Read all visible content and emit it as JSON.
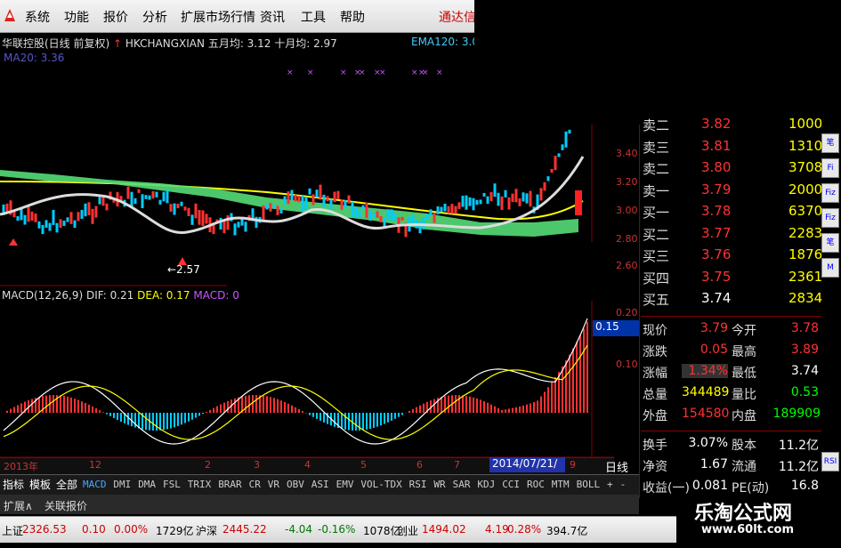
{
  "menu": {
    "items": [
      "系统",
      "功能",
      "报价",
      "分析",
      "扩展市场行情",
      "资讯",
      "工具",
      "帮助"
    ],
    "brand": "通达信"
  },
  "chart_header": {
    "stock_name": "华联控股(日线 前复权)",
    "indicator": "HKCHANGXIAN",
    "ma5": "五月均: 3.12",
    "ma10": "十月均: 2.97",
    "ema": "EMA120: 3.0",
    "ma20": "MA20: 3.36"
  },
  "price_ticks": [
    "3.40",
    "3.20",
    "3.00",
    "2.80",
    "2.60"
  ],
  "low_label": "←2.57",
  "macd": {
    "header_name": "MACD(12,26,9)",
    "dif": "DIF: 0.21",
    "dea": "DEA: 0.17",
    "macd": "MACD: 0",
    "ticks": [
      "0.20",
      "0.10"
    ],
    "value_box": "0.15"
  },
  "time_axis": {
    "year": "2013年",
    "labels": [
      "12",
      "2",
      "3",
      "4",
      "5",
      "6",
      "7",
      "9"
    ],
    "date_box": "2014/07/21/—",
    "period": "日线"
  },
  "order_book": [
    {
      "label": "卖二",
      "price": "3.82",
      "vol": "1000"
    },
    {
      "label": "卖三",
      "price": "3.81",
      "vol": "1310"
    },
    {
      "label": "卖二",
      "price": "3.80",
      "vol": "3708"
    },
    {
      "label": "卖一",
      "price": "3.79",
      "vol": "2000"
    },
    {
      "label": "买一",
      "price": "3.78",
      "vol": "6370"
    },
    {
      "label": "买二",
      "price": "3.77",
      "vol": "2283"
    },
    {
      "label": "买三",
      "price": "3.76",
      "vol": "1876"
    },
    {
      "label": "买四",
      "price": "3.75",
      "vol": "2361"
    },
    {
      "label": "买五",
      "price": "3.74",
      "vol": "2834"
    }
  ],
  "quote": [
    {
      "l1": "现价",
      "v1": "3.79",
      "l2": "今开",
      "v2": "3.78"
    },
    {
      "l1": "涨跌",
      "v1": "0.05",
      "l2": "最高",
      "v2": "3.89"
    },
    {
      "l1": "涨幅",
      "v1": "1.34%",
      "l2": "最低",
      "v2": "3.74"
    },
    {
      "l1": "总量",
      "v1": "344489",
      "l2": "量比",
      "v2": "0.53"
    },
    {
      "l1": "外盘",
      "v1": "154580",
      "l2": "内盘",
      "v2": "189909"
    }
  ],
  "fundamentals": [
    {
      "l1": "换手",
      "v1": "3.07%",
      "l2": "股本",
      "v2": "11.2亿"
    },
    {
      "l1": "净资",
      "v1": "1.67",
      "l2": "流通",
      "v2": "11.2亿"
    },
    {
      "l1": "收益(一)",
      "v1": "0.081",
      "l2": "PE(动)",
      "v2": "16.8"
    }
  ],
  "tabs": [
    "指标",
    "模板",
    "全部",
    "MACD",
    "DMI",
    "DMA",
    "FSL",
    "TRIX",
    "BRAR",
    "CR",
    "VR",
    "OBV",
    "ASI",
    "EMV",
    "VOL-TDX",
    "RSI",
    "WR",
    "SAR",
    "KDJ",
    "CCI",
    "ROC",
    "MTM",
    "BOLL",
    "+",
    "-"
  ],
  "bottom_row": [
    "扩展∧",
    "关联报价"
  ],
  "status_bar": {
    "sh_label": "上证",
    "sh_index": "2326.53",
    "sh_chg": "0.10",
    "sh_pct": "0.00%",
    "sh_amt": "1729亿",
    "sz_label": "沪深",
    "sz_index": "2445.22",
    "sz_chg": "-4.04",
    "sz_pct": "-0.16%",
    "sz_amt": "1078亿",
    "cy_label": "创业",
    "cy_index": "1494.02",
    "cy_chg": "4.19",
    "cy_pct": "0.28%",
    "cy_amt": "394.7亿"
  },
  "watermark": {
    "title": "乐淘公式网",
    "url": "www.60lt.com"
  },
  "side_buttons": [
    "笔",
    "Fi",
    "Fiz",
    "Fiz",
    "笔",
    "M",
    "RSI"
  ],
  "colors": {
    "up": "#ff3232",
    "down": "#00ffff",
    "yellow": "#ffff00",
    "ma": "#ffffff",
    "green_band": "#66ee88"
  }
}
